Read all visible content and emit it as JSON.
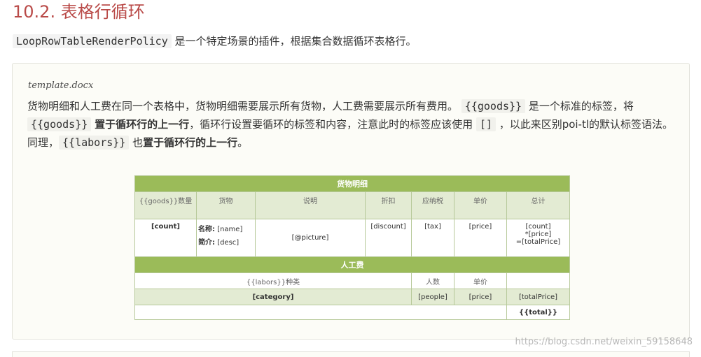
{
  "heading": "10.2. 表格行循环",
  "intro": {
    "code": "LoopRowTableRenderPolicy",
    "text": " 是一个特定场景的插件，根据集合数据循环表格行。"
  },
  "panel": {
    "filename": "template.docx",
    "p1": "货物明细和人工费在同一个表格中，货物明细需要展示所有货物，人工费需要展示所有费用。",
    "code_goods": "{{goods}}",
    "p2": " 是一个标准的标签，将 ",
    "p3_bold": "置于循环行的上一行",
    "p4": "，循环行设置要循环的标签和内容，注意此时的标签应该使用 ",
    "code_brackets": "[]",
    "p5": " ，以此来区别poi-tl的默认标签语法。同理，",
    "code_labors": "{{labors}}",
    "p6": " 也",
    "p7_bold": "置于循环行的上一行",
    "p8": "。"
  },
  "table": {
    "goods_title": "货物明细",
    "goods_headers": [
      "{{goods}}数量",
      "货物",
      "说明",
      "折扣",
      "应纳税",
      "单价",
      "总计"
    ],
    "count": "[count]",
    "name_label": "名称:",
    "name_val": "[name]",
    "desc_label": "简介:",
    "desc_val": "[desc]",
    "picture": "[@picture]",
    "discount": "[discount]",
    "tax": "[tax]",
    "price": "[price]",
    "total_line1": "[count]",
    "total_line2": "*[price]",
    "total_line3": "=[totalPrice]",
    "labor_title": "人工费",
    "labor_headers": [
      "{{labors}}种类",
      "人数",
      "单价"
    ],
    "category": "[category]",
    "people": "[people]",
    "labor_price": "[price]",
    "total_price": "[totalPrice]",
    "grand_total": "{{total}}"
  },
  "watermark": "https://blog.csdn.net/weixin_59158648"
}
